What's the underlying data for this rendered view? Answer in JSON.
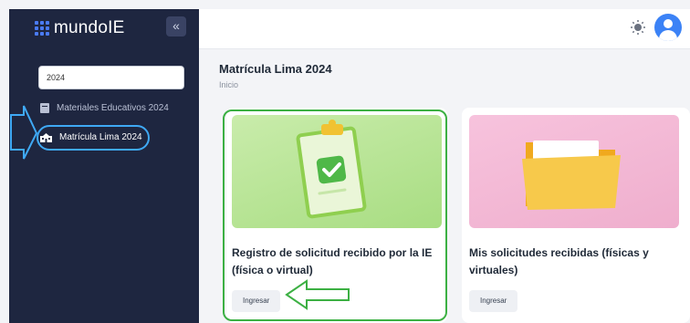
{
  "app": {
    "brand": "mundoIE",
    "collapse_icon": "«"
  },
  "sidebar": {
    "search_value": "2024",
    "items": [
      {
        "label": "Materiales Educativos 2024",
        "icon": "book-icon"
      },
      {
        "label": "Matrícula Lima 2024",
        "icon": "school-icon",
        "active": true
      }
    ]
  },
  "header": {
    "theme_icon": "sun-icon",
    "avatar_icon": "user-icon"
  },
  "main": {
    "title": "Matrícula Lima 2024",
    "breadcrumb": "Inicio",
    "cards": [
      {
        "title": "Registro de solicitud recibido por la IE (física o virtual)",
        "button": "Ingresar",
        "image": "clipboard-check-icon"
      },
      {
        "title": "Mis solicitudes recibidas (físicas y virtuales)",
        "button": "Ingresar",
        "image": "folder-icon"
      }
    ]
  },
  "colors": {
    "sidebar_bg": "#1e2640",
    "accent": "#3b82f6",
    "highlight_blue": "#3fa9f5",
    "highlight_green": "#3cb043"
  }
}
